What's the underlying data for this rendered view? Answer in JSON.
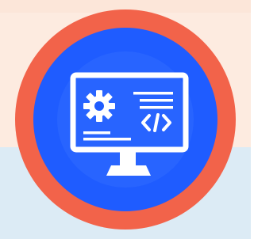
{
  "illustration": {
    "subject": "desktop-monitor-with-gear-and-code-icon",
    "icons": [
      "monitor-icon",
      "gear-icon",
      "code-brackets-icon"
    ]
  },
  "colors": {
    "background_top": "#fdebe0",
    "background_bottom": "#dcebf5",
    "outer_ring": "#f2634a",
    "inner_disc": "#1f5cff",
    "inner_glow": "#2f6bff",
    "icon_white": "#ffffff"
  }
}
